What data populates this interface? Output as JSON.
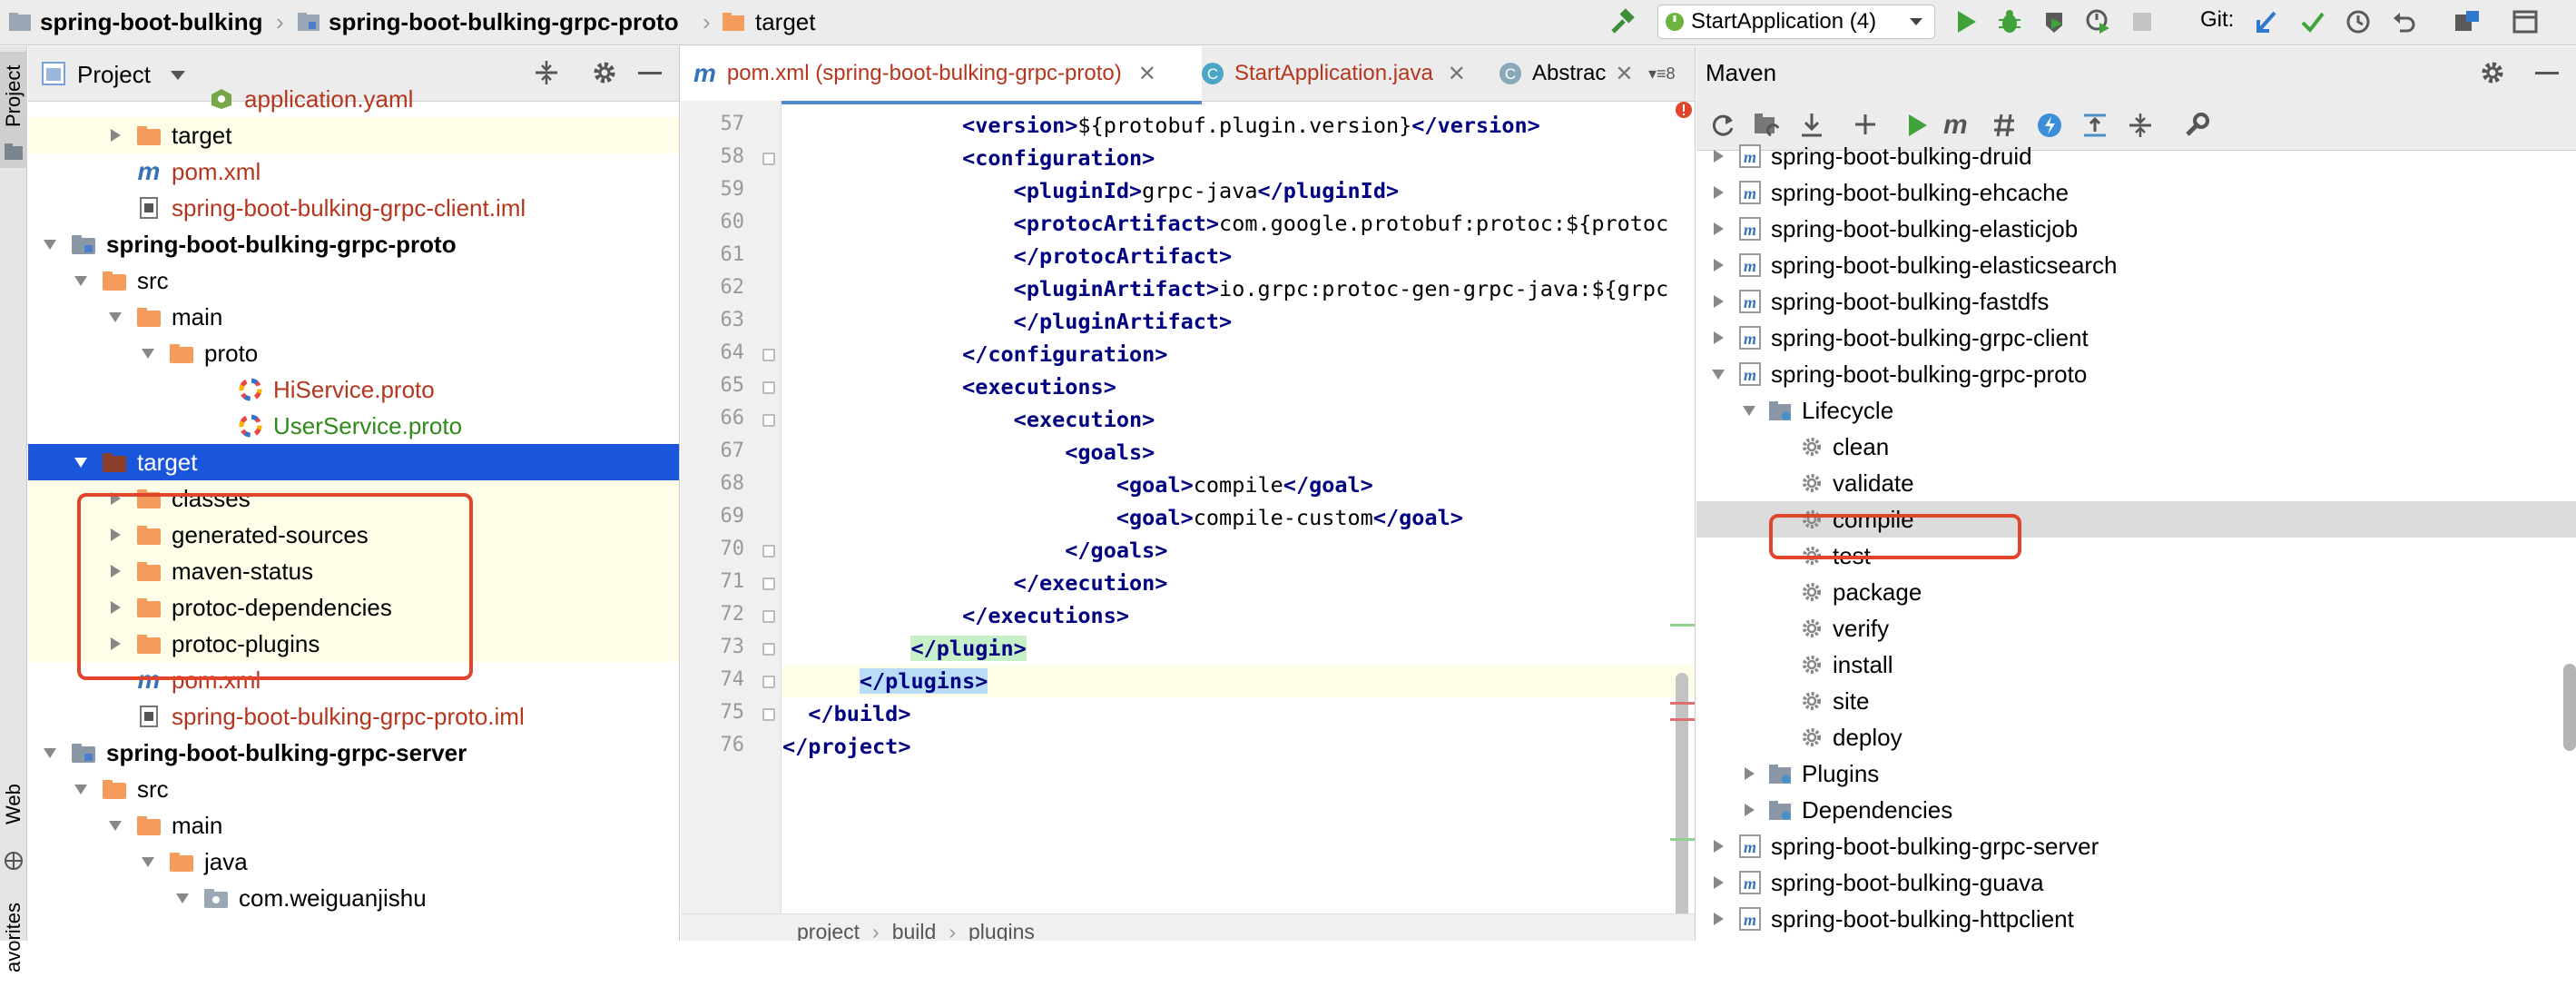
{
  "breadcrumb": {
    "items": [
      "spring-boot-bulking",
      "spring-boot-bulking-grpc-proto",
      "target"
    ]
  },
  "run_config": {
    "label": "StartApplication (4)"
  },
  "git": {
    "label": "Git:"
  },
  "side_tabs": {
    "project": "Project",
    "web": "Web",
    "favorites": "avorites"
  },
  "project_panel": {
    "title": "Project",
    "rows": [
      {
        "label": "application.yaml",
        "icon": "yaml-file-icon"
      },
      {
        "label": "target",
        "icon": "folder-icon"
      },
      {
        "label": "pom.xml",
        "icon": "maven-icon"
      },
      {
        "label": "spring-boot-bulking-grpc-client.iml",
        "icon": "iml-file-icon"
      },
      {
        "label": "spring-boot-bulking-grpc-proto",
        "icon": "module-folder-icon"
      },
      {
        "label": "src",
        "icon": "folder-icon"
      },
      {
        "label": "main",
        "icon": "folder-icon"
      },
      {
        "label": "proto",
        "icon": "folder-icon"
      },
      {
        "label": "HiService.proto",
        "icon": "proto-file-icon"
      },
      {
        "label": "UserService.proto",
        "icon": "proto-file-icon"
      },
      {
        "label": "target",
        "icon": "folder-icon"
      },
      {
        "label": "classes",
        "icon": "folder-icon"
      },
      {
        "label": "generated-sources",
        "icon": "folder-icon"
      },
      {
        "label": "maven-status",
        "icon": "folder-icon"
      },
      {
        "label": "protoc-dependencies",
        "icon": "folder-icon"
      },
      {
        "label": "protoc-plugins",
        "icon": "folder-icon"
      },
      {
        "label": "pom.xml",
        "icon": "maven-icon"
      },
      {
        "label": "spring-boot-bulking-grpc-proto.iml",
        "icon": "iml-file-icon"
      },
      {
        "label": "spring-boot-bulking-grpc-server",
        "icon": "module-folder-icon"
      },
      {
        "label": "src",
        "icon": "folder-icon"
      },
      {
        "label": "main",
        "icon": "folder-icon"
      },
      {
        "label": "java",
        "icon": "folder-icon"
      },
      {
        "label": "com.weiguanjishu",
        "icon": "package-icon"
      }
    ]
  },
  "editor": {
    "tabs": [
      {
        "label": "pom.xml (spring-boot-bulking-grpc-proto)",
        "icon": "maven-icon"
      },
      {
        "label": "StartApplication.java",
        "icon": "class-icon"
      },
      {
        "label": "Abstrac",
        "icon": "class-icon"
      }
    ],
    "tab_overflow": "8",
    "lines": [
      {
        "num": "57",
        "text": "              <version>${protobuf.plugin.version}</version>"
      },
      {
        "num": "58",
        "text": "              <configuration>"
      },
      {
        "num": "59",
        "text": "                  <pluginId>grpc-java</pluginId>"
      },
      {
        "num": "60",
        "text": "                  <protocArtifact>com.google.protobuf:protoc:${protoc"
      },
      {
        "num": "61",
        "text": "                  </protocArtifact>"
      },
      {
        "num": "62",
        "text": "                  <pluginArtifact>io.grpc:protoc-gen-grpc-java:${grpc"
      },
      {
        "num": "63",
        "text": "                  </pluginArtifact>"
      },
      {
        "num": "64",
        "text": "              </configuration>"
      },
      {
        "num": "65",
        "text": "              <executions>"
      },
      {
        "num": "66",
        "text": "                  <execution>"
      },
      {
        "num": "67",
        "text": "                      <goals>"
      },
      {
        "num": "68",
        "text": "                          <goal>compile</goal>"
      },
      {
        "num": "69",
        "text": "                          <goal>compile-custom</goal>"
      },
      {
        "num": "70",
        "text": "                      </goals>"
      },
      {
        "num": "71",
        "text": "                  </execution>"
      },
      {
        "num": "72",
        "text": "              </executions>"
      },
      {
        "num": "73",
        "text": "          </plugin>"
      },
      {
        "num": "74",
        "text": "      </plugins>"
      },
      {
        "num": "75",
        "text": "  </build>"
      },
      {
        "num": "76",
        "text": "</project>"
      }
    ],
    "status_breadcrumb": [
      "project",
      "build",
      "plugins"
    ]
  },
  "maven": {
    "title": "Maven",
    "rows": [
      {
        "label": "spring-boot-bulking-druid",
        "kind": "module"
      },
      {
        "label": "spring-boot-bulking-ehcache",
        "kind": "module"
      },
      {
        "label": "spring-boot-bulking-elasticjob",
        "kind": "module"
      },
      {
        "label": "spring-boot-bulking-elasticsearch",
        "kind": "module"
      },
      {
        "label": "spring-boot-bulking-fastdfs",
        "kind": "module"
      },
      {
        "label": "spring-boot-bulking-grpc-client",
        "kind": "module"
      },
      {
        "label": "spring-boot-bulking-grpc-proto",
        "kind": "module"
      },
      {
        "label": "Lifecycle",
        "kind": "folder"
      },
      {
        "label": "clean",
        "kind": "goal"
      },
      {
        "label": "validate",
        "kind": "goal"
      },
      {
        "label": "compile",
        "kind": "goal"
      },
      {
        "label": "test",
        "kind": "goal"
      },
      {
        "label": "package",
        "kind": "goal"
      },
      {
        "label": "verify",
        "kind": "goal"
      },
      {
        "label": "install",
        "kind": "goal"
      },
      {
        "label": "site",
        "kind": "goal"
      },
      {
        "label": "deploy",
        "kind": "goal"
      },
      {
        "label": "Plugins",
        "kind": "folder"
      },
      {
        "label": "Dependencies",
        "kind": "folder"
      },
      {
        "label": "spring-boot-bulking-grpc-server",
        "kind": "module"
      },
      {
        "label": "spring-boot-bulking-guava",
        "kind": "module"
      },
      {
        "label": "spring-boot-bulking-httpclient",
        "kind": "module"
      }
    ]
  },
  "colors": {
    "selection": "#1a56db",
    "highlight_box": "#e0442b",
    "target_row_bg": "#fdfde8",
    "tag": "#000080",
    "file_red": "#b5361d",
    "file_green": "#2f8a1a",
    "folder_orange": "#f59b5c"
  }
}
